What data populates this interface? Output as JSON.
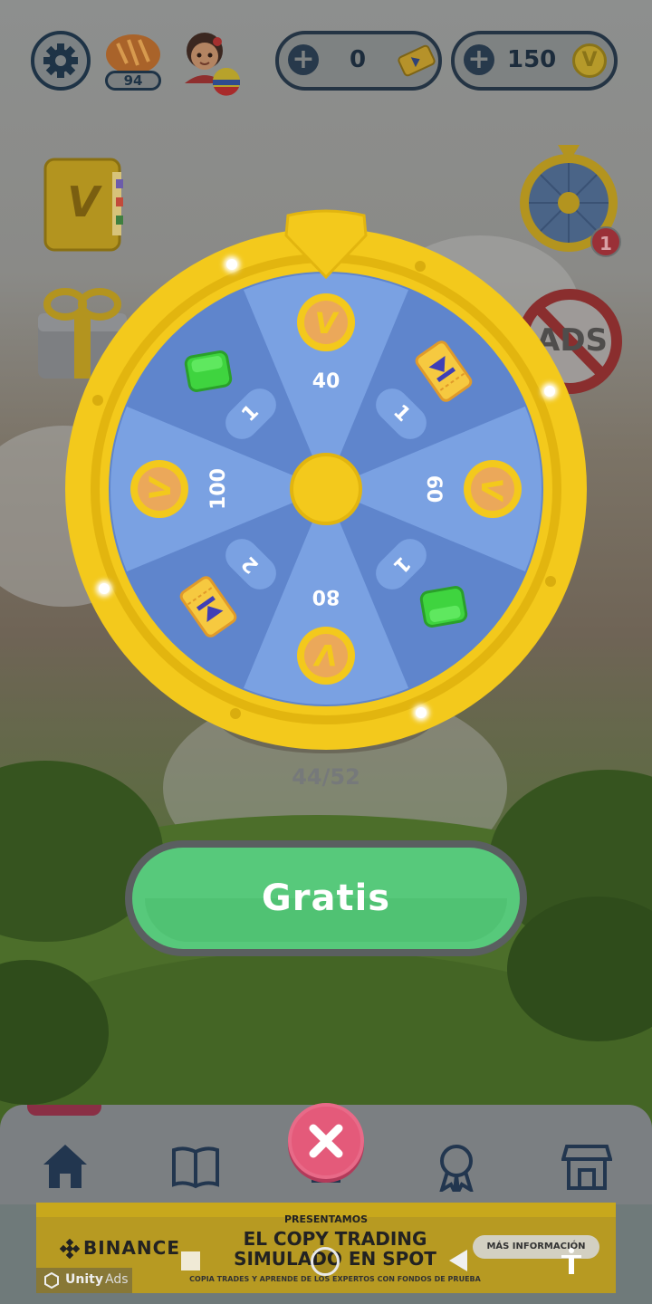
{
  "header": {
    "level_badge": "94",
    "tickets_count": "0",
    "coins_count": "150"
  },
  "wheel": {
    "progress_text": "44/52",
    "segments": [
      {
        "label": "40",
        "reward": "coin"
      },
      {
        "label": "1",
        "reward": "ticket"
      },
      {
        "label": "60",
        "reward": "coin"
      },
      {
        "label": "1",
        "reward": "gem"
      },
      {
        "label": "80",
        "reward": "coin"
      },
      {
        "label": "2",
        "reward": "ticket"
      },
      {
        "label": "100",
        "reward": "coin"
      },
      {
        "label": "1",
        "reward": "gem"
      }
    ],
    "coin_glyph": "V",
    "notification_count": "1"
  },
  "cta": {
    "label": "Gratis"
  },
  "side": {
    "book_glyph": "V",
    "ads_text": "ADS"
  },
  "ad": {
    "brand": "BINANCE",
    "kicker": "PRESENTAMOS",
    "headline_1": "EL COPY TRADING",
    "headline_2": "SIMULADO EN SPOT",
    "sub": "COPIA TRADES Y APRENDE DE LOS EXPERTOS CON FONDOS DE PRUEBA",
    "more": "MÁS INFORMACIÓN",
    "provider": "Unity",
    "provider_suffix": "Ads"
  },
  "colors": {
    "wheel_gold": "#f3c91c",
    "wheel_blue_light": "#7aa1e2",
    "wheel_blue_dark": "#5f85cc",
    "cta_green": "#57c97b",
    "close_pink": "#e45a7a"
  }
}
